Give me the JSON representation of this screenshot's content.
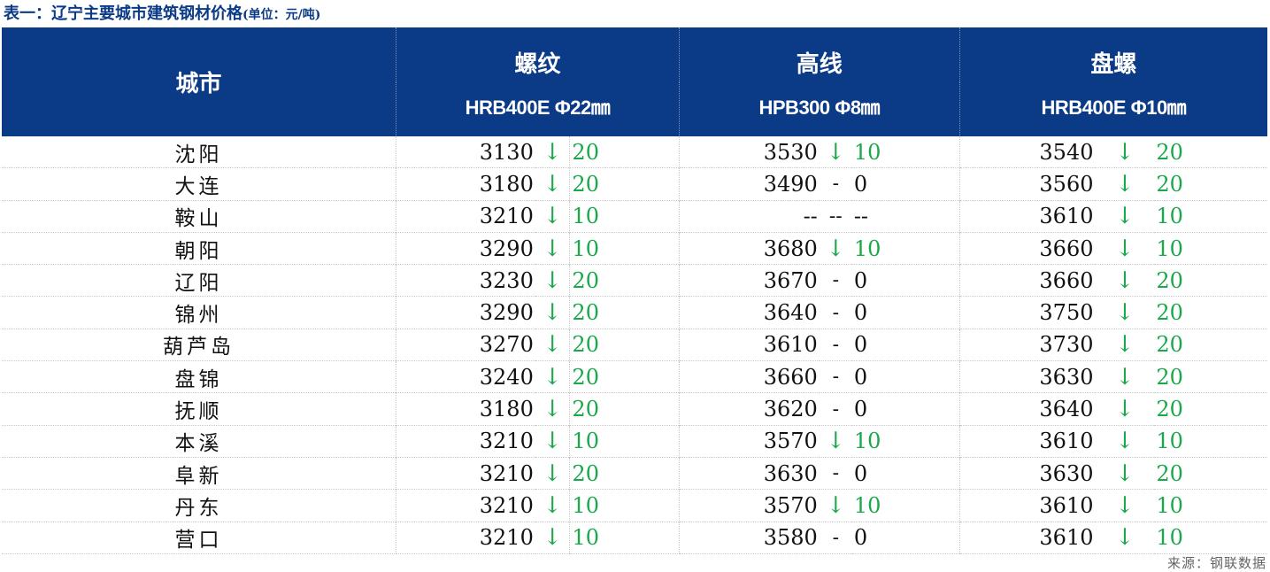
{
  "title": "表一：辽宁主要城市建筑钢材价格",
  "unit": "(单位：元/吨)",
  "headers": {
    "city": "城市",
    "groups": [
      {
        "name": "螺纹",
        "spec": "HRB400E Φ22㎜"
      },
      {
        "name": "高线",
        "spec": "HPB300 Φ8㎜"
      },
      {
        "name": "盘螺",
        "spec": "HRB400E Φ10㎜"
      }
    ]
  },
  "rows": [
    {
      "city": "沈阳",
      "rebar": {
        "price": "3130",
        "dir": "↓",
        "chg": "20"
      },
      "wire": {
        "price": "3530",
        "dir": "↓",
        "chg": "10"
      },
      "coil": {
        "price": "3540",
        "dir": "↓",
        "chg": "20"
      }
    },
    {
      "city": "大连",
      "rebar": {
        "price": "3180",
        "dir": "↓",
        "chg": "20"
      },
      "wire": {
        "price": "3490",
        "dir": "-",
        "chg": "0"
      },
      "coil": {
        "price": "3560",
        "dir": "↓",
        "chg": "20"
      }
    },
    {
      "city": "鞍山",
      "rebar": {
        "price": "3210",
        "dir": "↓",
        "chg": "10"
      },
      "wire": {
        "price": "--",
        "dir": "--",
        "chg": "--"
      },
      "coil": {
        "price": "3610",
        "dir": "↓",
        "chg": "10"
      }
    },
    {
      "city": "朝阳",
      "rebar": {
        "price": "3290",
        "dir": "↓",
        "chg": "10"
      },
      "wire": {
        "price": "3680",
        "dir": "↓",
        "chg": "10"
      },
      "coil": {
        "price": "3660",
        "dir": "↓",
        "chg": "10"
      }
    },
    {
      "city": "辽阳",
      "rebar": {
        "price": "3230",
        "dir": "↓",
        "chg": "20"
      },
      "wire": {
        "price": "3670",
        "dir": "-",
        "chg": "0"
      },
      "coil": {
        "price": "3660",
        "dir": "↓",
        "chg": "20"
      }
    },
    {
      "city": "锦州",
      "rebar": {
        "price": "3290",
        "dir": "↓",
        "chg": "20"
      },
      "wire": {
        "price": "3640",
        "dir": "-",
        "chg": "0"
      },
      "coil": {
        "price": "3750",
        "dir": "↓",
        "chg": "20"
      }
    },
    {
      "city": "葫芦岛",
      "rebar": {
        "price": "3270",
        "dir": "↓",
        "chg": "20"
      },
      "wire": {
        "price": "3610",
        "dir": "-",
        "chg": "0"
      },
      "coil": {
        "price": "3730",
        "dir": "↓",
        "chg": "20"
      }
    },
    {
      "city": "盘锦",
      "rebar": {
        "price": "3240",
        "dir": "↓",
        "chg": "20"
      },
      "wire": {
        "price": "3660",
        "dir": "-",
        "chg": "0"
      },
      "coil": {
        "price": "3630",
        "dir": "↓",
        "chg": "20"
      }
    },
    {
      "city": "抚顺",
      "rebar": {
        "price": "3180",
        "dir": "↓",
        "chg": "20"
      },
      "wire": {
        "price": "3620",
        "dir": "-",
        "chg": "0"
      },
      "coil": {
        "price": "3640",
        "dir": "↓",
        "chg": "20"
      }
    },
    {
      "city": "本溪",
      "rebar": {
        "price": "3210",
        "dir": "↓",
        "chg": "10"
      },
      "wire": {
        "price": "3570",
        "dir": "↓",
        "chg": "10"
      },
      "coil": {
        "price": "3610",
        "dir": "↓",
        "chg": "10"
      }
    },
    {
      "city": "阜新",
      "rebar": {
        "price": "3210",
        "dir": "↓",
        "chg": "20"
      },
      "wire": {
        "price": "3630",
        "dir": "-",
        "chg": "0"
      },
      "coil": {
        "price": "3630",
        "dir": "↓",
        "chg": "20"
      }
    },
    {
      "city": "丹东",
      "rebar": {
        "price": "3210",
        "dir": "↓",
        "chg": "10"
      },
      "wire": {
        "price": "3570",
        "dir": "↓",
        "chg": "10"
      },
      "coil": {
        "price": "3610",
        "dir": "↓",
        "chg": "10"
      }
    },
    {
      "city": "营口",
      "rebar": {
        "price": "3210",
        "dir": "↓",
        "chg": "10"
      },
      "wire": {
        "price": "3580",
        "dir": "-",
        "chg": "0"
      },
      "coil": {
        "price": "3610",
        "dir": "↓",
        "chg": "10"
      }
    }
  ],
  "colors": {
    "header_bg": "#0b3a86",
    "down": "#1aa84a",
    "text": "#111111"
  },
  "source": "来源：钢联数据"
}
